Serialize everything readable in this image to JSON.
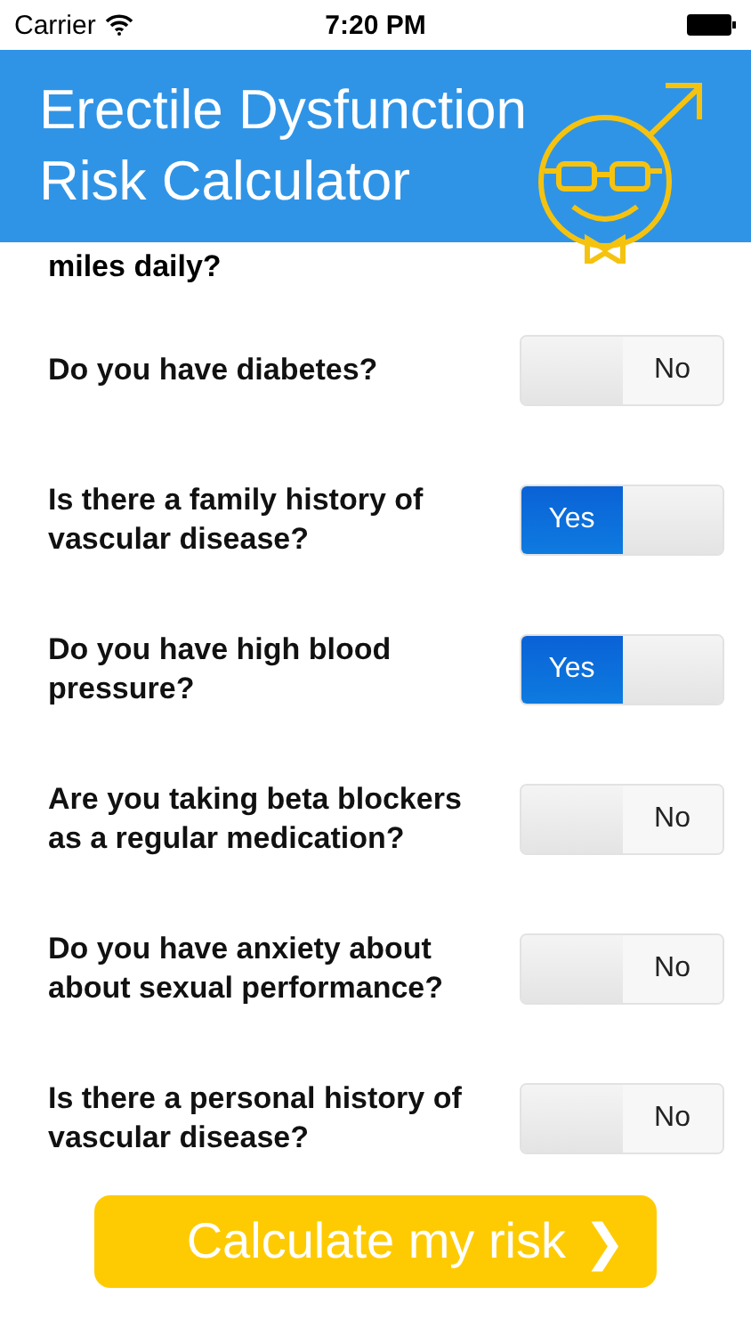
{
  "status_bar": {
    "carrier": "Carrier",
    "time": "7:20 PM"
  },
  "header": {
    "title_lines": [
      "Erectile Dysfunction",
      "Risk Calculator"
    ]
  },
  "partial_question": "miles daily?",
  "questions": [
    {
      "text": "Do you have diabetes?",
      "on": false,
      "label": "No"
    },
    {
      "text": "Is there a family history of vascular disease?",
      "on": true,
      "label": "Yes"
    },
    {
      "text": "Do you have high blood pressure?",
      "on": true,
      "label": "Yes"
    },
    {
      "text": "Are you taking beta blockers as a regular medication?",
      "on": false,
      "label": "No"
    },
    {
      "text": "Do you have anxiety about about sexual performance?",
      "on": false,
      "label": "No"
    },
    {
      "text": "Is there a personal history of vascular disease?",
      "on": false,
      "label": "No"
    }
  ],
  "calculate_button": {
    "label": "Calculate my risk",
    "chevron": "❯"
  }
}
